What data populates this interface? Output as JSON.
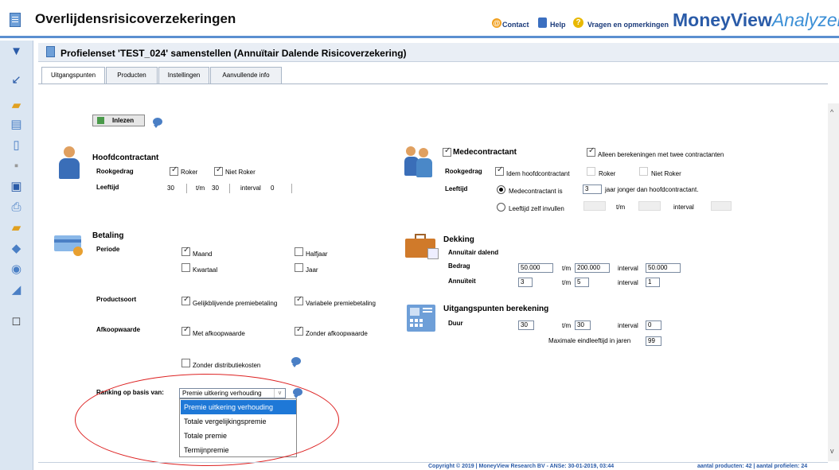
{
  "app": {
    "title": "Overlijdensrisicoverzekeringen",
    "brand_main": "MoneyView",
    "brand_sub": "Analyzer"
  },
  "header_links": {
    "contact": "Contact",
    "help": "Help",
    "feedback": "Vragen en opmerkingen"
  },
  "panel": {
    "title": "Profielenset 'TEST_024' samenstellen (Annuïtair Dalende Risicoverzekering)"
  },
  "tabs": [
    "Uitgangspunten",
    "Producten",
    "Instellingen",
    "Aanvullende info"
  ],
  "inlezen": "Inlezen",
  "hoofd": {
    "title": "Hoofdcontractant",
    "rookgedrag_label": "Rookgedrag",
    "roker": "Roker",
    "niet_roker": "Niet Roker",
    "leeftijd_label": "Leeftijd",
    "from": "30",
    "tm": "t/m",
    "to": "30",
    "interval_label": "interval",
    "interval": "0"
  },
  "mede": {
    "title": "Medecontractant",
    "alleen": "Alleen berekeningen met twee contractanten",
    "rookgedrag_label": "Rookgedrag",
    "idem": "Idem hoofdcontractant",
    "roker": "Roker",
    "niet_roker": "Niet Roker",
    "leeftijd_label": "Leeftijd",
    "radio1": "Medecontractant is",
    "radio1_value": "3",
    "radio1_suffix": "jaar jonger dan hoofdcontractant.",
    "radio2": "Leeftijd zelf invullen",
    "tm": "t/m",
    "interval_label": "interval"
  },
  "betaling": {
    "title": "Betaling",
    "periode_label": "Periode",
    "maand": "Maand",
    "halfjaar": "Halfjaar",
    "kwartaal": "Kwartaal",
    "jaar": "Jaar",
    "productsoort_label": "Productsoort",
    "gelijk": "Gelijkblijvende premiebetaling",
    "variabel": "Variabele premiebetaling",
    "afkoop_label": "Afkoopwaarde",
    "met": "Met afkoopwaarde",
    "zonder": "Zonder afkoopwaarde",
    "distributie": "Zonder distributiekosten"
  },
  "dekking": {
    "title": "Dekking",
    "sub": "Annuïtair dalend",
    "bedrag_label": "Bedrag",
    "bedrag_from": "50.000",
    "tm": "t/m",
    "bedrag_to": "200.000",
    "interval_label": "interval",
    "bedrag_interval": "50.000",
    "annuiteit_label": "Annuïteit",
    "ann_from": "3",
    "ann_to": "5",
    "ann_interval": "1"
  },
  "berekening": {
    "title": "Uitgangspunten berekening",
    "duur_label": "Duur",
    "duur_from": "30",
    "tm": "t/m",
    "duur_to": "30",
    "interval_label": "interval",
    "duur_interval": "0",
    "max_label": "Maximale eindleeftijd in jaren",
    "max_value": "99"
  },
  "ranking": {
    "label": "Ranking op basis van:",
    "selected": "Premie uitkering verhouding",
    "options": [
      "Premie uitkering verhouding",
      "Totale vergelijkingspremie",
      "Totale premie",
      "Termijnpremie"
    ]
  },
  "footer": {
    "copyright": "Copyright © 2019 | MoneyView Research BV - ANSe: 30-01-2019, 03:44",
    "counts": "aantal producten: 42 | aantal profielen: 24"
  }
}
